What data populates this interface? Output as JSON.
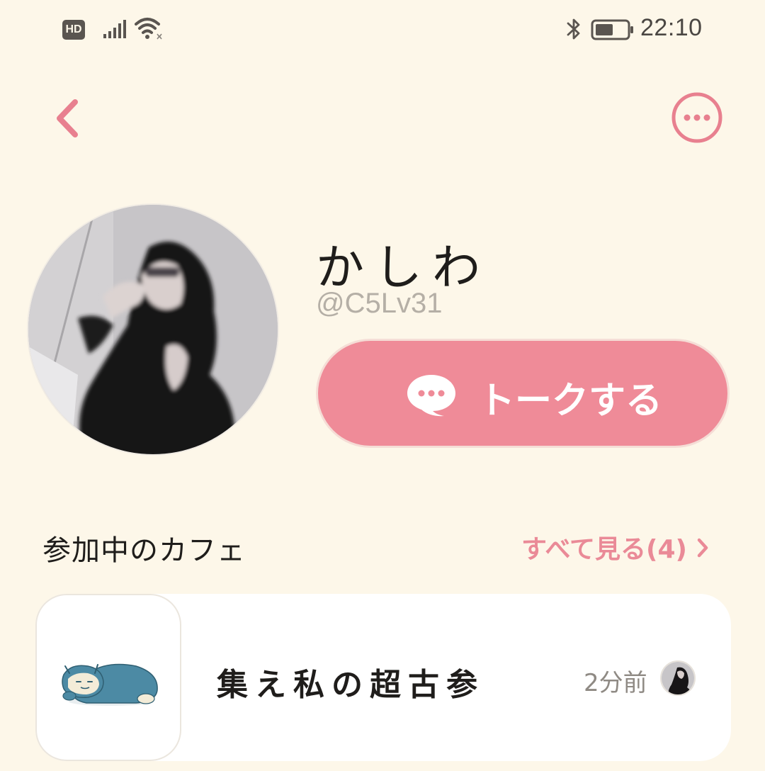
{
  "status_bar": {
    "hd_badge": "HD",
    "time": "22:10",
    "icons": [
      "hd-icon",
      "signal-icon",
      "wifi-icon",
      "bluetooth-icon",
      "battery-icon"
    ]
  },
  "header": {
    "back_icon": "chevron-left-icon",
    "more_icon": "more-horizontal-circle-icon"
  },
  "profile": {
    "display_name": "かしわ",
    "handle": "@C5Lv31",
    "talk_button_label": "トークする",
    "talk_button_icon": "chat-bubble-icon"
  },
  "cafes_section": {
    "title": "参加中のカフェ",
    "see_all_label": "すべて見る(4)",
    "see_all_icon": "chevron-right-icon",
    "items": [
      {
        "name": "集え私の超古参",
        "time": "2分前",
        "thumbnail_icon": "sleeping-creature-illustration",
        "member_avatar_icon": "member-avatar"
      }
    ]
  },
  "colors": {
    "background": "#fdf7e9",
    "accent": "#ef8b98",
    "accent_text": "#ea8a97",
    "card": "#ffffff",
    "muted_text": "#b5afa6"
  }
}
